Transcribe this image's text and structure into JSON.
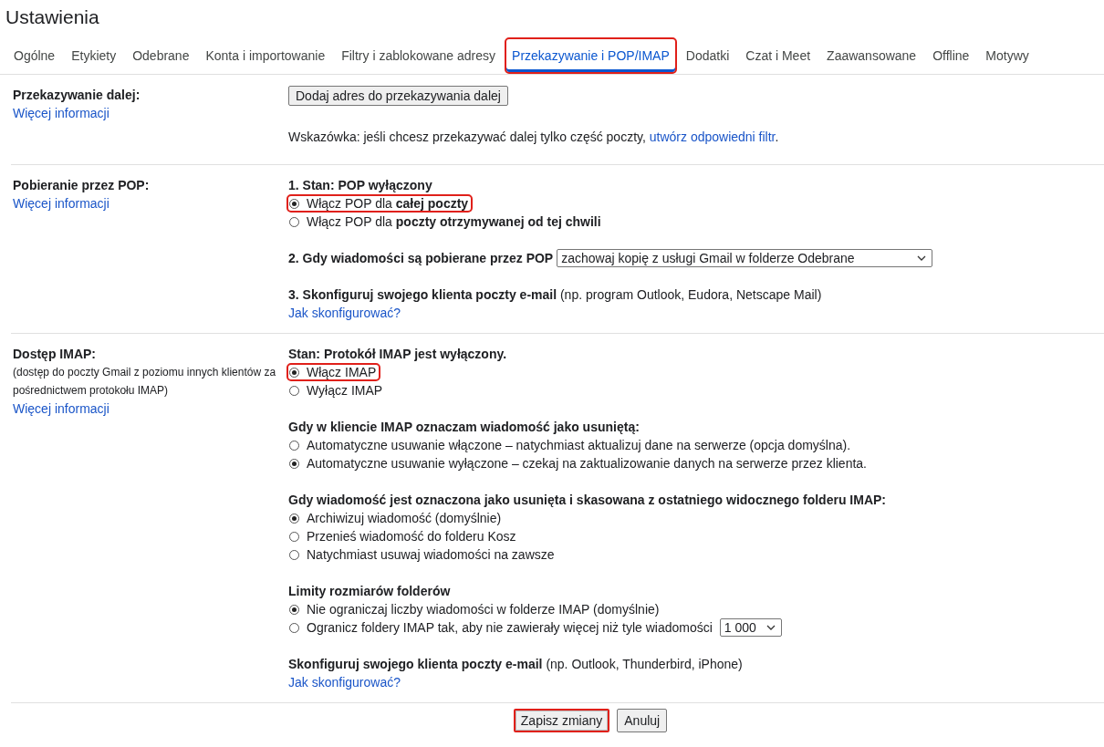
{
  "page_title": "Ustawienia",
  "tabs": [
    {
      "label": "Ogólne",
      "selected": false,
      "highlighted": false
    },
    {
      "label": "Etykiety",
      "selected": false,
      "highlighted": false
    },
    {
      "label": "Odebrane",
      "selected": false,
      "highlighted": false
    },
    {
      "label": "Konta i importowanie",
      "selected": false,
      "highlighted": false
    },
    {
      "label": "Filtry i zablokowane adresy",
      "selected": false,
      "highlighted": false
    },
    {
      "label": "Przekazywanie i POP/IMAP",
      "selected": true,
      "highlighted": true
    },
    {
      "label": "Dodatki",
      "selected": false,
      "highlighted": false
    },
    {
      "label": "Czat i Meet",
      "selected": false,
      "highlighted": false
    },
    {
      "label": "Zaawansowane",
      "selected": false,
      "highlighted": false
    },
    {
      "label": "Offline",
      "selected": false,
      "highlighted": false
    },
    {
      "label": "Motywy",
      "selected": false,
      "highlighted": false
    }
  ],
  "sections": [
    {
      "title": "Przekazywanie dalej:",
      "link": "Więcej informacji",
      "blocks": [
        {
          "kind": "button",
          "label": "Dodaj adres do przekazywania dalej"
        },
        {
          "kind": "hint",
          "text": "Wskazówka: jeśli chcesz przekazywać dalej tylko część poczty,",
          "link": "utwórz odpowiedni filtr",
          "tail": "."
        }
      ]
    },
    {
      "title": "Pobieranie przez POP:",
      "link": "Więcej informacji",
      "blocks": [
        {
          "kind": "radios",
          "heading": "1. Stan: POP wyłączony",
          "options": [
            {
              "label": "Włącz POP dla **całej poczty**",
              "selected": true,
              "highlighted": true
            },
            {
              "label": "Włącz POP dla **poczty otrzymywanej od tej chwili**",
              "selected": false,
              "highlighted": false
            }
          ]
        },
        {
          "kind": "select",
          "label": "2. Gdy wiadomości są pobierane przez POP",
          "value": "zachowaj kopię z usługi Gmail w folderze Odebrane"
        },
        {
          "kind": "setup",
          "heading": "**3. Skonfiguruj swojego klienta poczty e-mail** (np. program Outlook, Eudora, Netscape Mail)",
          "link": "Jak skonfigurować?"
        }
      ]
    },
    {
      "title": "Dostęp IMAP:",
      "note": "(dostęp do poczty Gmail z poziomu innych klientów za pośrednictwem protokołu IMAP)",
      "link": "Więcej informacji",
      "blocks": [
        {
          "kind": "radios",
          "heading": "Stan: Protokół IMAP jest wyłączony.",
          "options": [
            {
              "label": "Włącz IMAP",
              "selected": true,
              "highlighted": true
            },
            {
              "label": "Wyłącz IMAP",
              "selected": false,
              "highlighted": false
            }
          ]
        },
        {
          "kind": "radios",
          "heading": "Gdy w kliencie IMAP oznaczam wiadomość jako usuniętą:",
          "options": [
            {
              "label": "Automatyczne usuwanie włączone – natychmiast aktualizuj dane na serwerze (opcja domyślna).",
              "selected": false,
              "highlighted": false
            },
            {
              "label": "Automatyczne usuwanie wyłączone – czekaj na zaktualizowanie danych na serwerze przez klienta.",
              "selected": true,
              "highlighted": false
            }
          ]
        },
        {
          "kind": "radios",
          "heading": "Gdy wiadomość jest oznaczona jako usunięta i skasowana z ostatniego widocznego folderu IMAP:",
          "options": [
            {
              "label": "Archiwizuj wiadomość (domyślnie)",
              "selected": true,
              "highlighted": false
            },
            {
              "label": "Przenieś wiadomość do folderu Kosz",
              "selected": false,
              "highlighted": false
            },
            {
              "label": "Natychmiast usuwaj wiadomości na zawsze",
              "selected": false,
              "highlighted": false
            }
          ]
        },
        {
          "kind": "radios",
          "heading": "Limity rozmiarów folderów",
          "options": [
            {
              "label": "Nie ograniczaj liczby wiadomości w folderze IMAP (domyślnie)",
              "selected": true,
              "highlighted": false
            },
            {
              "label": "Ogranicz foldery IMAP tak, aby nie zawierały więcej niż tyle wiadomości",
              "selected": false,
              "highlighted": false,
              "select": "1 000"
            }
          ]
        },
        {
          "kind": "setup",
          "heading": "**Skonfiguruj swojego klienta poczty e-mail** (np. Outlook, Thunderbird, iPhone)",
          "link": "Jak skonfigurować?"
        }
      ]
    }
  ],
  "actions": [
    {
      "label": "Zapisz zmiany",
      "highlighted": true
    },
    {
      "label": "Anuluj",
      "highlighted": false
    }
  ]
}
